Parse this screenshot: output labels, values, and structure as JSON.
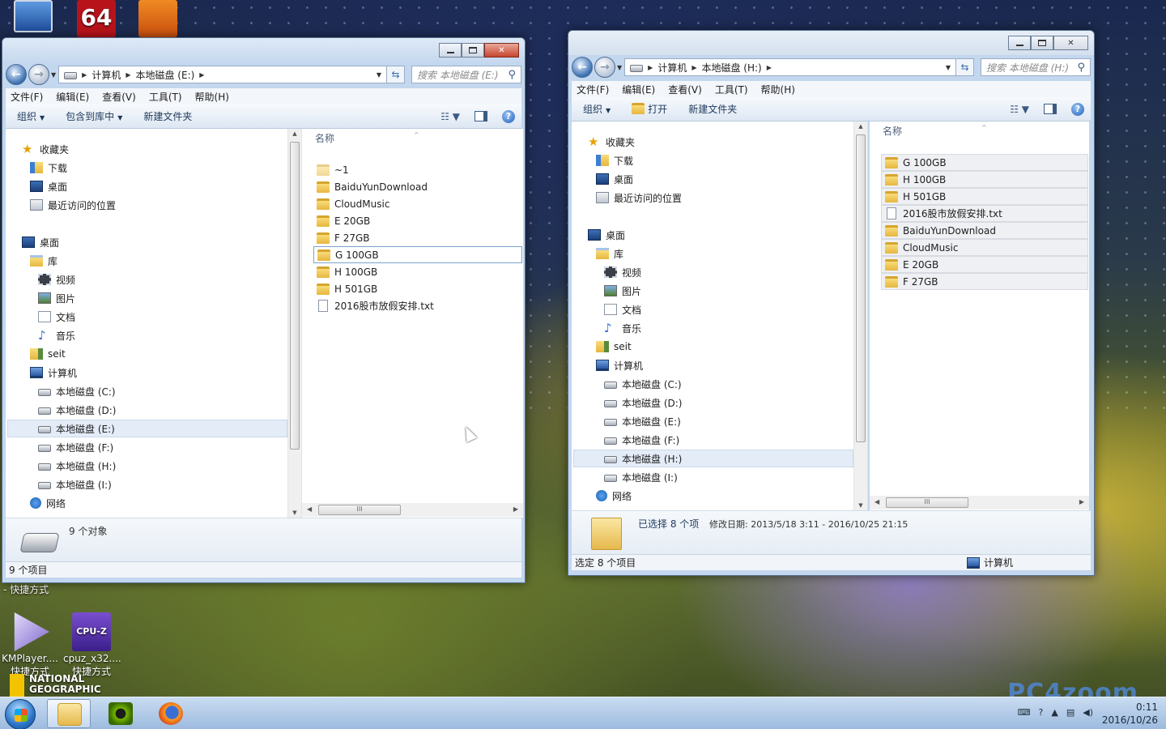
{
  "desktop": {
    "icons": [
      {
        "label": "KMPlayer....",
        "sublabel": "快捷方式"
      },
      {
        "label": "cpuz_x32....",
        "sublabel": "快捷方式"
      }
    ],
    "cpuz_badge": "CPU-Z",
    "top_icon_64": "64",
    "shortcut_label_left": "- 快捷方式",
    "ng_logo": "NATIONAL GEOGRAPHIC",
    "watermark": "PC4zoom"
  },
  "win_left": {
    "breadcrumb": [
      "计算机",
      "本地磁盘 (E:)"
    ],
    "search_placeholder": "搜索 本地磁盘 (E:)",
    "menu": [
      "文件(F)",
      "编辑(E)",
      "查看(V)",
      "工具(T)",
      "帮助(H)"
    ],
    "commands": [
      "组织",
      "包含到库中",
      "新建文件夹"
    ],
    "nav": {
      "favorites": "收藏夹",
      "downloads": "下载",
      "desktop_fav": "桌面",
      "recent": "最近访问的位置",
      "desktop": "桌面",
      "libraries": "库",
      "videos": "视频",
      "pictures": "图片",
      "documents": "文档",
      "music": "音乐",
      "user": "seit",
      "computer": "计算机",
      "drives": [
        "本地磁盘 (C:)",
        "本地磁盘 (D:)",
        "本地磁盘 (E:)",
        "本地磁盘 (F:)",
        "本地磁盘 (H:)",
        "本地磁盘 (I:)"
      ],
      "network": "网络"
    },
    "column_name": "名称",
    "files": [
      "~1",
      "BaiduYunDownload",
      "CloudMusic",
      "E 20GB",
      "F 27GB",
      "G 100GB",
      "H 100GB",
      "H 501GB",
      "2016股市放假安排.txt"
    ],
    "details_text": "9 个对象",
    "status_text": "9 个项目"
  },
  "win_right": {
    "breadcrumb": [
      "计算机",
      "本地磁盘 (H:)"
    ],
    "search_placeholder": "搜索 本地磁盘 (H:)",
    "menu": [
      "文件(F)",
      "编辑(E)",
      "查看(V)",
      "工具(T)",
      "帮助(H)"
    ],
    "commands": [
      "组织",
      "打开",
      "新建文件夹"
    ],
    "nav": {
      "favorites": "收藏夹",
      "downloads": "下载",
      "desktop_fav": "桌面",
      "recent": "最近访问的位置",
      "desktop": "桌面",
      "libraries": "库",
      "videos": "视频",
      "pictures": "图片",
      "documents": "文档",
      "music": "音乐",
      "user": "seit",
      "computer": "计算机",
      "drives": [
        "本地磁盘 (C:)",
        "本地磁盘 (D:)",
        "本地磁盘 (E:)",
        "本地磁盘 (F:)",
        "本地磁盘 (H:)",
        "本地磁盘 (I:)"
      ],
      "network": "网络"
    },
    "column_name": "名称",
    "files": [
      "G 100GB",
      "H 100GB",
      "H 501GB",
      "2016股市放假安排.txt",
      "BaiduYunDownload",
      "CloudMusic",
      "E 20GB",
      "F 27GB"
    ],
    "details_selected": "已选择 8 个项",
    "details_modified": "修改日期: 2013/5/18 3:11 - 2016/10/25 21:15",
    "status_text": "选定 8 个项目",
    "status_location": "计算机"
  },
  "taskbar": {
    "time": "0:11",
    "date": "2016/10/26"
  }
}
